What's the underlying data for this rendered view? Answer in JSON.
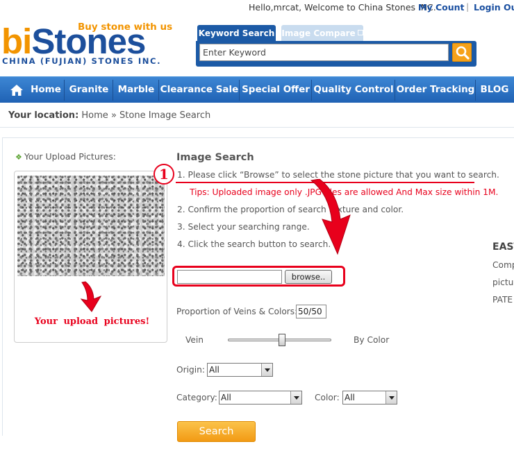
{
  "topbar": {
    "greeting": "Hello,mrcat, Welcome to China Stones INC.",
    "my_count": "My Count",
    "separator": "|",
    "login_out": "Login Out"
  },
  "logo": {
    "slogan": "Buy stone with us",
    "brand_part1": "bi",
    "brand_part2": "Stones",
    "company": "CHINA (FUJIAN) STONES INC."
  },
  "search": {
    "tab_keyword": "Keyword Search",
    "tab_image_compare": "Image Compare",
    "placeholder": "Enter Keyword"
  },
  "nav": {
    "items": [
      "Home",
      "Granite",
      "Marble",
      "Clearance Sale",
      "Special Offer",
      "Quality Control",
      "Order Tracking",
      "BLOG"
    ]
  },
  "location": {
    "label": "Your location:",
    "home": "Home",
    "sep": "»",
    "current": "Stone Image Search"
  },
  "upload": {
    "heading": "Your Upload Pictures:",
    "annotation": "Your upload pictures!"
  },
  "image_search": {
    "title": "Image Search",
    "steps": [
      "1. Please click “Browse” to select the stone picture that you want to search.",
      "2. Confirm the proportion of search texture and color.",
      "3. Select your searching range.",
      "4. Click the search button to search."
    ],
    "tips": "Tips: Uploaded image only .JPG files are allowed And Max size within 1M.",
    "step_badge": "1",
    "browse_label": "browse..",
    "proportion_label": "Proportion of Veins & Colors:",
    "proportion_value": "50/50",
    "slider_left": "Vein",
    "slider_right": "By Color",
    "slider_value_fraction": 0.5,
    "origin_label": "Origin:",
    "origin_value": "All",
    "category_label": "Category:",
    "category_value": "All",
    "color_label": "Color:",
    "color_value": "All",
    "search_button": "Search"
  },
  "side_cut": {
    "heading": "EAST",
    "line1": "Comp",
    "line2": "pictur",
    "line3": "PATE"
  },
  "colors": {
    "brand_blue": "#1c4f9c",
    "brand_orange": "#f29400",
    "nav_blue": "#2b72c2",
    "annotation_red": "#e8001c",
    "button_orange": "#f6a21a"
  }
}
